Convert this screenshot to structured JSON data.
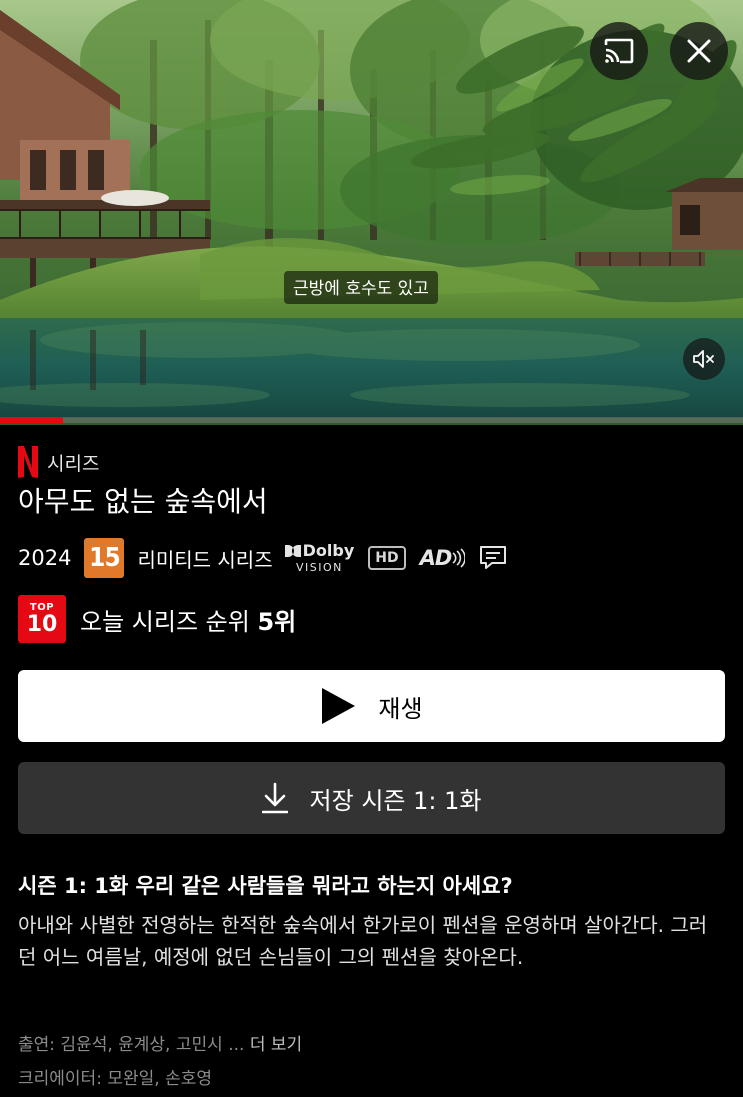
{
  "hero": {
    "subtitle": "근방에 호수도 있고",
    "progress": 0.085
  },
  "info": {
    "type_label": "시리즈",
    "title": "아무도 없는 숲속에서",
    "year": "2024",
    "rating": "15",
    "format": "리미티드 시리즈",
    "dolby_top": "Dolby",
    "dolby_bottom": "VISION",
    "hd": "HD",
    "ad": "AD",
    "top10_top": "TOP",
    "top10_num": "10",
    "rank_prefix": "오늘 시리즈 순위",
    "rank_value": "5위"
  },
  "actions": {
    "play_label": "재생",
    "download_label": "저장 시즌 1: 1화"
  },
  "episode": {
    "title": "시즌 1: 1화 우리 같은 사람들을 뭐라고 하는지 아세요?",
    "description": "아내와 사별한 전영하는 한적한 숲속에서 한가로이 펜션을 운영하며 살아간다. 그러던 어느 여름날, 예정에 없던 손님들이 그의 펜션을 찾아온다."
  },
  "credits": {
    "cast": "출연: 김윤석, 윤계상, 고민시 ...",
    "more": "더 보기",
    "creators": "크리에이터: 모완일, 손호영"
  },
  "colors": {
    "brand_red": "#e50914",
    "rating_orange": "#e07a2a",
    "download_button": "#333333"
  },
  "icons": [
    "cast-icon",
    "close-icon",
    "mute-icon",
    "play-icon",
    "download-icon",
    "netflix-n-icon",
    "subtitles-icon"
  ]
}
